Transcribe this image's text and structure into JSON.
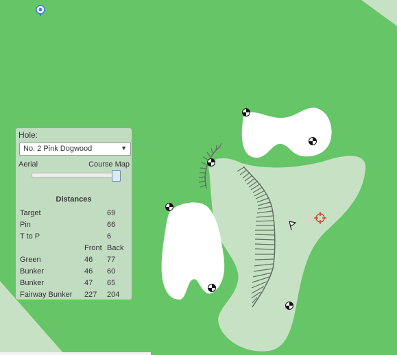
{
  "panel": {
    "hole_label": "Hole:",
    "hole_select": "No. 2 Pink Dogwood",
    "mode_aerial": "Aerial",
    "mode_course_map": "Course Map",
    "slider_value": 1.0,
    "distances_title": "Distances",
    "target": {
      "label": "Target",
      "value": "69"
    },
    "pin": {
      "label": "Pin",
      "value": "66"
    },
    "t_to_p": {
      "label": "T to P",
      "value": "6"
    },
    "header_front": "Front",
    "header_back": "Back",
    "rows": [
      {
        "label": "Green",
        "front": "46",
        "back": "77"
      },
      {
        "label": "Bunker",
        "front": "46",
        "back": "60"
      },
      {
        "label": "Bunker",
        "front": "47",
        "back": "65"
      },
      {
        "label": "Fairway Bunker",
        "front": "227",
        "back": "204"
      }
    ]
  },
  "colors": {
    "rough": "#66c566",
    "fairway": "#c7e1c4",
    "bunker": "#ffffff",
    "target": "#e02020"
  }
}
